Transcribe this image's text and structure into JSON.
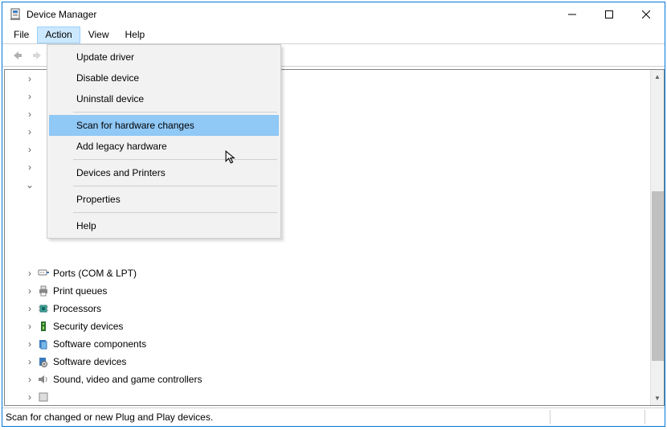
{
  "window": {
    "title": "Device Manager"
  },
  "menubar": {
    "file": "File",
    "action": "Action",
    "view": "View",
    "help": "Help"
  },
  "action_menu": {
    "update_driver": "Update driver",
    "disable_device": "Disable device",
    "uninstall_device": "Uninstall device",
    "scan_hardware": "Scan for hardware changes",
    "add_legacy": "Add legacy hardware",
    "devices_printers": "Devices and Printers",
    "properties": "Properties",
    "help": "Help"
  },
  "tree": {
    "items": [
      {
        "label": "Ports (COM & LPT)"
      },
      {
        "label": "Print queues"
      },
      {
        "label": "Processors"
      },
      {
        "label": "Security devices"
      },
      {
        "label": "Software components"
      },
      {
        "label": "Software devices"
      },
      {
        "label": "Sound, video and game controllers"
      }
    ]
  },
  "statusbar": {
    "text": "Scan for changed or new Plug and Play devices."
  }
}
